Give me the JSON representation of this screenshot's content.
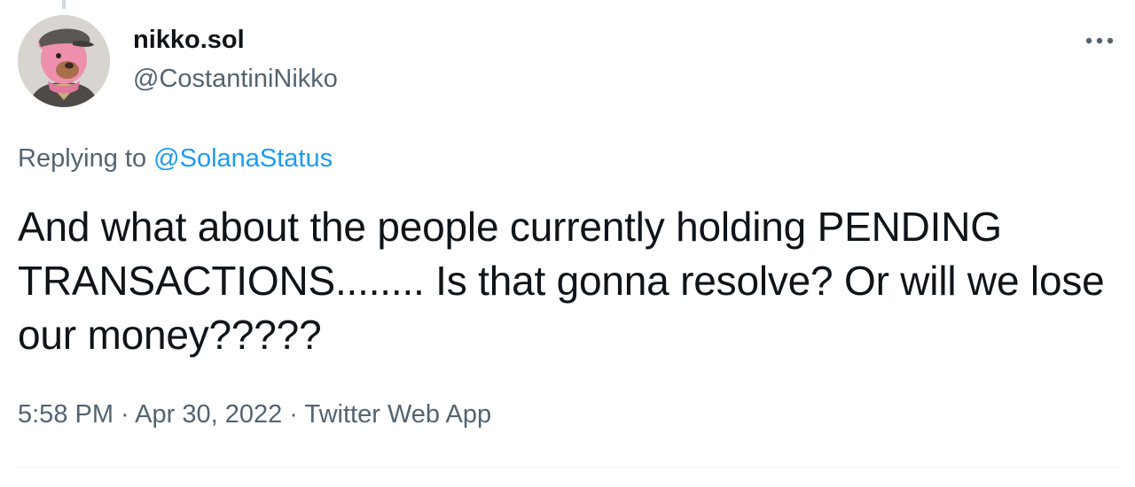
{
  "author": {
    "display_name": "nikko.sol",
    "handle": "@CostantiniNikko",
    "avatar_icon": "bear-avatar-icon"
  },
  "more_icon": "more-horizontal-icon",
  "reply": {
    "prefix": "Replying to ",
    "mention": "@SolanaStatus"
  },
  "tweet": {
    "text": "And what about the people currently holding PENDING TRANSACTIONS........ Is that gonna resolve? Or will we lose our money?????"
  },
  "meta": {
    "time": "5:58 PM",
    "separator": " · ",
    "date": "Apr 30, 2022",
    "source": "Twitter Web App"
  },
  "colors": {
    "text": "#0f1419",
    "secondary": "#536471",
    "link": "#1d9bf0",
    "divider": "#eff3f4"
  }
}
